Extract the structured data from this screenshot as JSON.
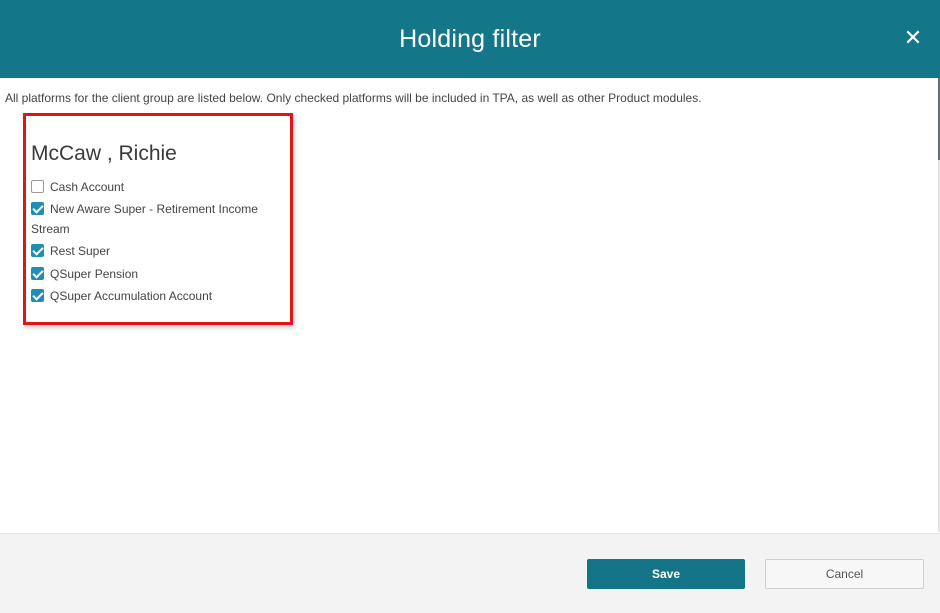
{
  "dialog": {
    "title": "Holding filter",
    "close_icon": "close-icon",
    "close_glyph": "✕"
  },
  "intro_text": "All platforms for the client group are listed below. Only checked platforms will be included in TPA, as well as other Product modules.",
  "client_group": {
    "name": "McCaw , Richie",
    "platforms": [
      {
        "label": "Cash Account",
        "checked": false
      },
      {
        "label": "New Aware Super - Retirement Income Stream",
        "checked": true
      },
      {
        "label": "Rest Super",
        "checked": true
      },
      {
        "label": "QSuper Pension",
        "checked": true
      },
      {
        "label": "QSuper Accumulation Account",
        "checked": true
      }
    ]
  },
  "footer": {
    "save_label": "Save",
    "cancel_label": "Cancel"
  },
  "colors": {
    "header_bg": "#137689",
    "save_bg": "#157588",
    "checkbox_checked": "#1e8db7",
    "highlight_border": "#e0141b"
  }
}
